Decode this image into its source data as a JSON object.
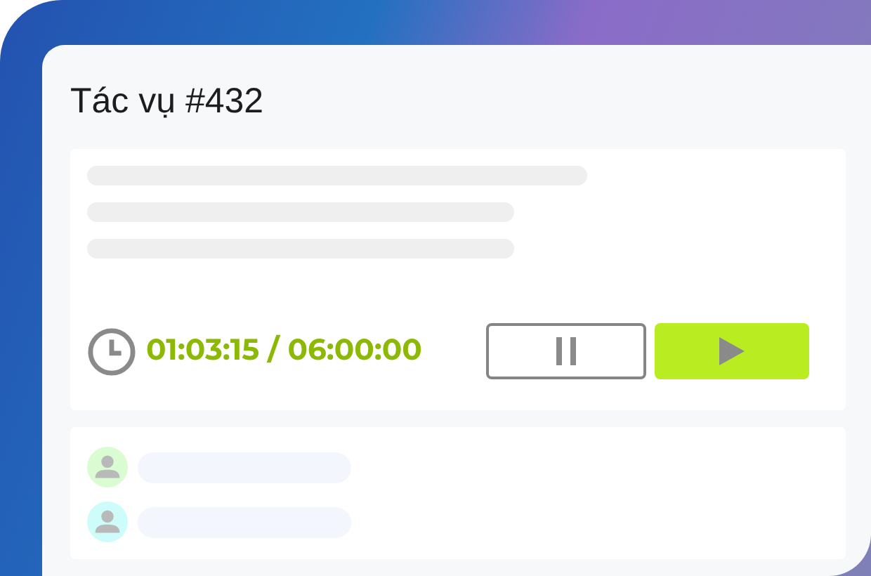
{
  "task": {
    "title": "Tác vụ #432"
  },
  "timer": {
    "reading": "01:03:15 / 06:00:00"
  },
  "members": [
    {
      "color": "#dafcd2"
    },
    {
      "color": "#cdfcfb"
    }
  ]
}
